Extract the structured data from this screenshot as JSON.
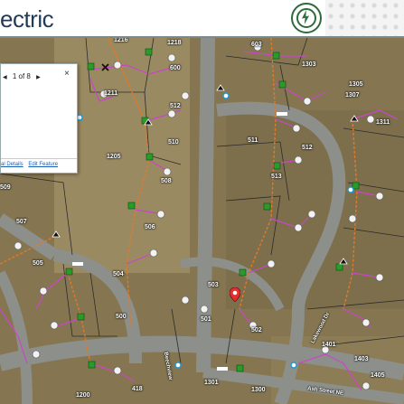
{
  "header": {
    "app_title": "ectric",
    "logo_name": "utility-cooperative-logo"
  },
  "popup": {
    "prev_label": "◀",
    "pager_text": "1 of 8",
    "next_label": "▶",
    "close_label": "×",
    "links": [
      "al Details",
      "Edit Feature"
    ]
  },
  "map": {
    "parcels": [
      "1216",
      "1218",
      "600",
      "603",
      "1211",
      "512",
      "510",
      "509",
      "508",
      "507",
      "506",
      "505",
      "504",
      "503",
      "502",
      "501",
      "500",
      "511",
      "1303",
      "1305",
      "1311",
      "1307",
      "1401",
      "1403",
      "1405",
      "1301",
      "1300",
      "1200",
      "1205",
      "418",
      "512",
      "513"
    ],
    "streets": [
      "Lakewood Dr",
      "Ash Street NE",
      "Beechview"
    ],
    "colors": {
      "primary_line": "#e07a2a",
      "secondary_line": "#cc44cc",
      "node": "#2a9a2a",
      "pin": "#e03030"
    }
  }
}
